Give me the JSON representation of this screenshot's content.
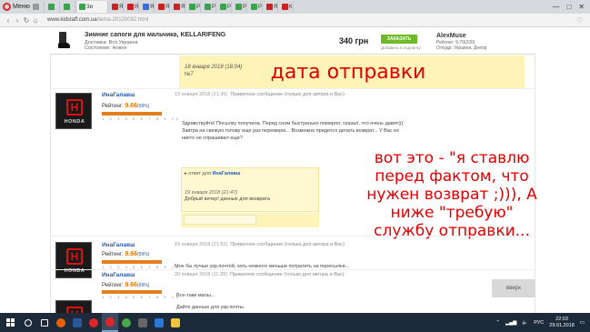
{
  "browser": {
    "menu_label": "Меню",
    "active_tab_label": "Зи",
    "tabs": [
      {
        "label": "",
        "color": "#999999",
        "icon": "tab-icon"
      },
      {
        "label": "",
        "color": "#3aa34d",
        "icon": "tab-icon"
      },
      {
        "label": "",
        "color": "#3aa34d",
        "icon": "tab-icon"
      },
      {
        "label": "Я",
        "color": "#cc2222",
        "icon": "tab-icon"
      },
      {
        "label": "Я",
        "color": "#cc2222",
        "icon": "tab-icon"
      },
      {
        "label": "Я",
        "color": "#3a6fd8",
        "icon": "tab-icon"
      },
      {
        "label": "Я",
        "color": "#cc2222",
        "icon": "tab-icon"
      },
      {
        "label": "Я",
        "color": "#cc2222",
        "icon": "tab-icon"
      },
      {
        "label": "Р",
        "color": "#3aa34d",
        "icon": "tab-icon"
      },
      {
        "label": "Р",
        "color": "#3aa34d",
        "icon": "tab-icon"
      },
      {
        "label": "Р",
        "color": "#3aa34d",
        "icon": "tab-icon"
      },
      {
        "label": "Р",
        "color": "#3aa34d",
        "icon": "tab-icon"
      },
      {
        "label": "Р",
        "color": "#3aa34d",
        "icon": "tab-icon"
      },
      {
        "label": "Я",
        "color": "#cc2222",
        "icon": "tab-icon"
      },
      {
        "label": "К",
        "color": "#cc2222",
        "icon": "tab-icon"
      }
    ],
    "url_domain": "www.kidstaff.com.ua",
    "url_path": "/tema-20120092.html"
  },
  "product": {
    "title": "Зимние сапоги для мальчика, KELLARIFENG",
    "delivery": "Доставка: Вся Украина",
    "condition": "Состояние: Новое",
    "price": "340 грн",
    "buy_label": "ЗАКАЗАТЬ",
    "buy_sub": "Добавить в подписку",
    "seller_name": "AlexMuse",
    "seller_rating": "Рейтинг: 9.70(100)",
    "seller_location": "Откуда: Украина, Днепр"
  },
  "partial_message": {
    "date": "18 января 2018 (18:04)",
    "extra": "№7"
  },
  "messages": [
    {
      "username": "ИнаГалавш",
      "rating_label": "Рейтинг:",
      "rating_value": "9.66",
      "rating_pct": "(99%)",
      "ticks": "1 2 3 4 5 6 7 8 9 10",
      "date": "19 января 2018 (21:36)",
      "type": "Приватное сообщение (только для автора и Вас)",
      "text": "Здравствуйте! Посылку получила. Перед сном быстренько померял, сказал, что очень давят((( Завтра на свежую голову еще раз перемерю... Возможно придется делать возврат... У Вас их никто не спрашивал еще?",
      "quote": {
        "head_prefix": "ответ для",
        "head_user": "ИнаГалавш",
        "date": "19 января 2018 (21:47)",
        "text": "Добрый вечер! данные для возврата"
      }
    },
    {
      "username": "ИнаГалавш",
      "rating_label": "Рейтинг:",
      "rating_value": "9.66",
      "rating_pct": "(99%)",
      "ticks": "1 2 3 4 5 6 7 8 9 10",
      "date": "19 января 2018 (21:51)",
      "type": "Приватное сообщение (только для автора и Вас)",
      "text": "Мне бы лучше укр.почтой, хоть немного меньше потратить на пересылки..."
    },
    {
      "username": "ИнаГалавш",
      "rating_label": "Рейтинг:",
      "rating_value": "9.66",
      "rating_pct": "(99%)",
      "ticks": "1 2 3 4 5 6 7 8 9 10",
      "date": "20 января 2018 (11:39)",
      "type": "Приватное сообщение (только для автора и Вас)",
      "text1": "Все-таки малы...",
      "text2": "Дайте данные для укр.почты."
    }
  ],
  "annotations": {
    "top": "дата отправки",
    "line1": "вот это - \"я ставлю",
    "line2": "перед фактом, что",
    "line3": "нужен возврат ;))), А",
    "line4": "ниже \"требую\"",
    "line5": "службу отправки..."
  },
  "up_button": "вверх",
  "taskbar": {
    "apps": [
      {
        "name": "search",
        "color": "#ffffff"
      },
      {
        "name": "task-view",
        "color": "#ffffff"
      },
      {
        "name": "firefox",
        "color": "#e66000"
      },
      {
        "name": "word",
        "color": "#2b579a"
      },
      {
        "name": "opera",
        "color": "#e0262a"
      },
      {
        "name": "opera-active",
        "color": "#e0262a"
      },
      {
        "name": "chrome",
        "color": "#4aa84a"
      },
      {
        "name": "calculator",
        "color": "#666666"
      },
      {
        "name": "photos",
        "color": "#2b78d6"
      },
      {
        "name": "explorer",
        "color": "#f2c53d"
      }
    ],
    "language": "РУС",
    "time": "22:03",
    "date": "29.01.2018"
  },
  "colors": {
    "annotation": "#e00000",
    "highlight": "#fff4b8",
    "rating_bar": "#e57e1f",
    "link": "#2a5db0",
    "buy_button": "#6dbb2a"
  }
}
